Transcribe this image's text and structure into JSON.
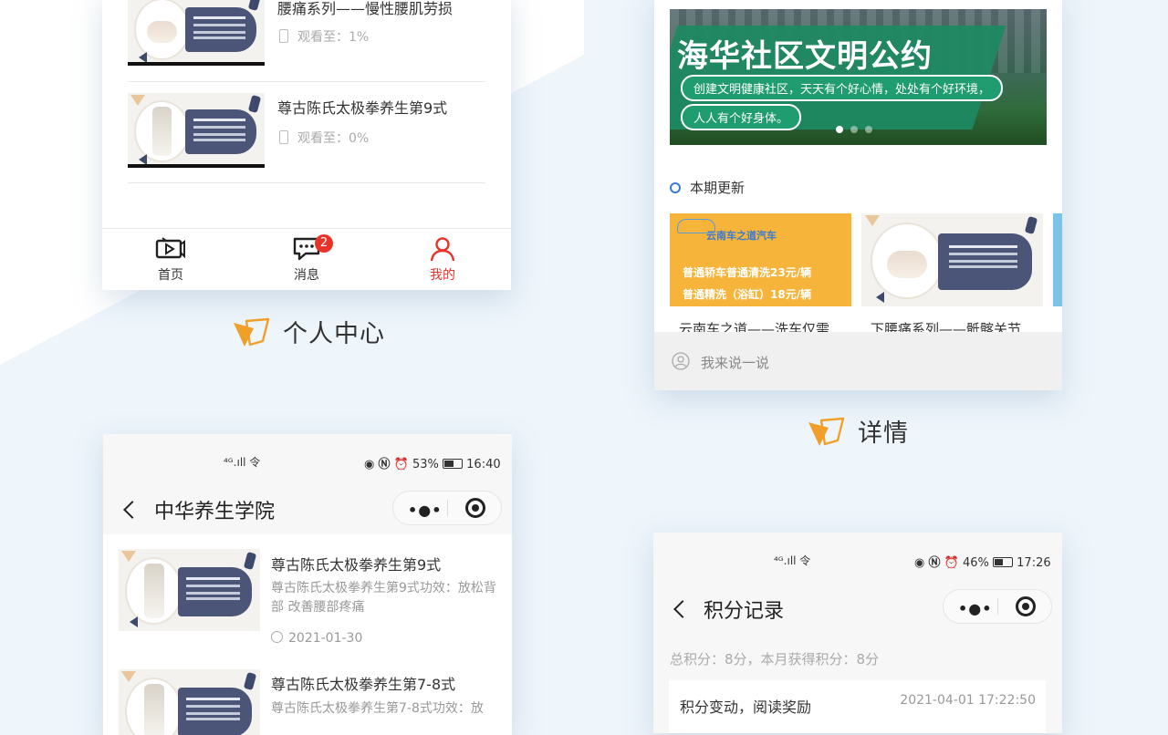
{
  "colors": {
    "accent": "#e8332a",
    "orange": "#f0a028",
    "navy": "#4a5578",
    "bg": "#eef5fb"
  },
  "personal_center": {
    "items": [
      {
        "title": "腰痛系列——慢性腰肌劳损",
        "progress": "观看至：1%"
      },
      {
        "title": "尊古陈氏太极拳养生第9式",
        "progress": "观看至：0%"
      }
    ],
    "tabbar": [
      {
        "label": "首页",
        "icon": "video-icon"
      },
      {
        "label": "消息",
        "icon": "chat-icon",
        "badge": "2"
      },
      {
        "label": "我的",
        "icon": "user-icon"
      }
    ],
    "section_label": "个人中心"
  },
  "details": {
    "banner": {
      "title": "海华社区文明公约",
      "line1": "创建文明健康社区，天天有个好心情，处处有个好环境，",
      "line2": "人人有个好身体。"
    },
    "section_heading": "本期更新",
    "cards": [
      {
        "title": "云南车之道——洗车仅需",
        "img_brand": "云南车之道汽车",
        "img_line1": "普通轿车普通清洗23元/辆",
        "img_line2": "普通精洗（浴缸）18元/辆"
      },
      {
        "title": "下腰痛系列——骶髂关节"
      }
    ],
    "comment_placeholder": "我来说一说",
    "section_label": "详情"
  },
  "academy": {
    "status": {
      "signal": "⁴ᴳ.ıll 令",
      "battery": "53%",
      "time": "16:40"
    },
    "title": "中华养生学院",
    "items": [
      {
        "title": "尊古陈氏太极拳养生第9式",
        "desc": "尊古陈氏太极拳养生第9式功效：放松背部 改善腰部疼痛",
        "date": "2021-01-30"
      },
      {
        "title": "尊古陈氏太极拳养生第7-8式",
        "desc": "尊古陈氏太极拳养生第7-8式功效：放"
      }
    ]
  },
  "points": {
    "status": {
      "signal": "⁴ᴳ.ıll 令",
      "battery": "46%",
      "time": "17:26"
    },
    "title": "积分记录",
    "summary": "总积分：8分，本月获得积分：8分",
    "records": [
      {
        "label": "积分变动，阅读奖励",
        "time": "2021-04-01 17:22:50"
      }
    ]
  }
}
